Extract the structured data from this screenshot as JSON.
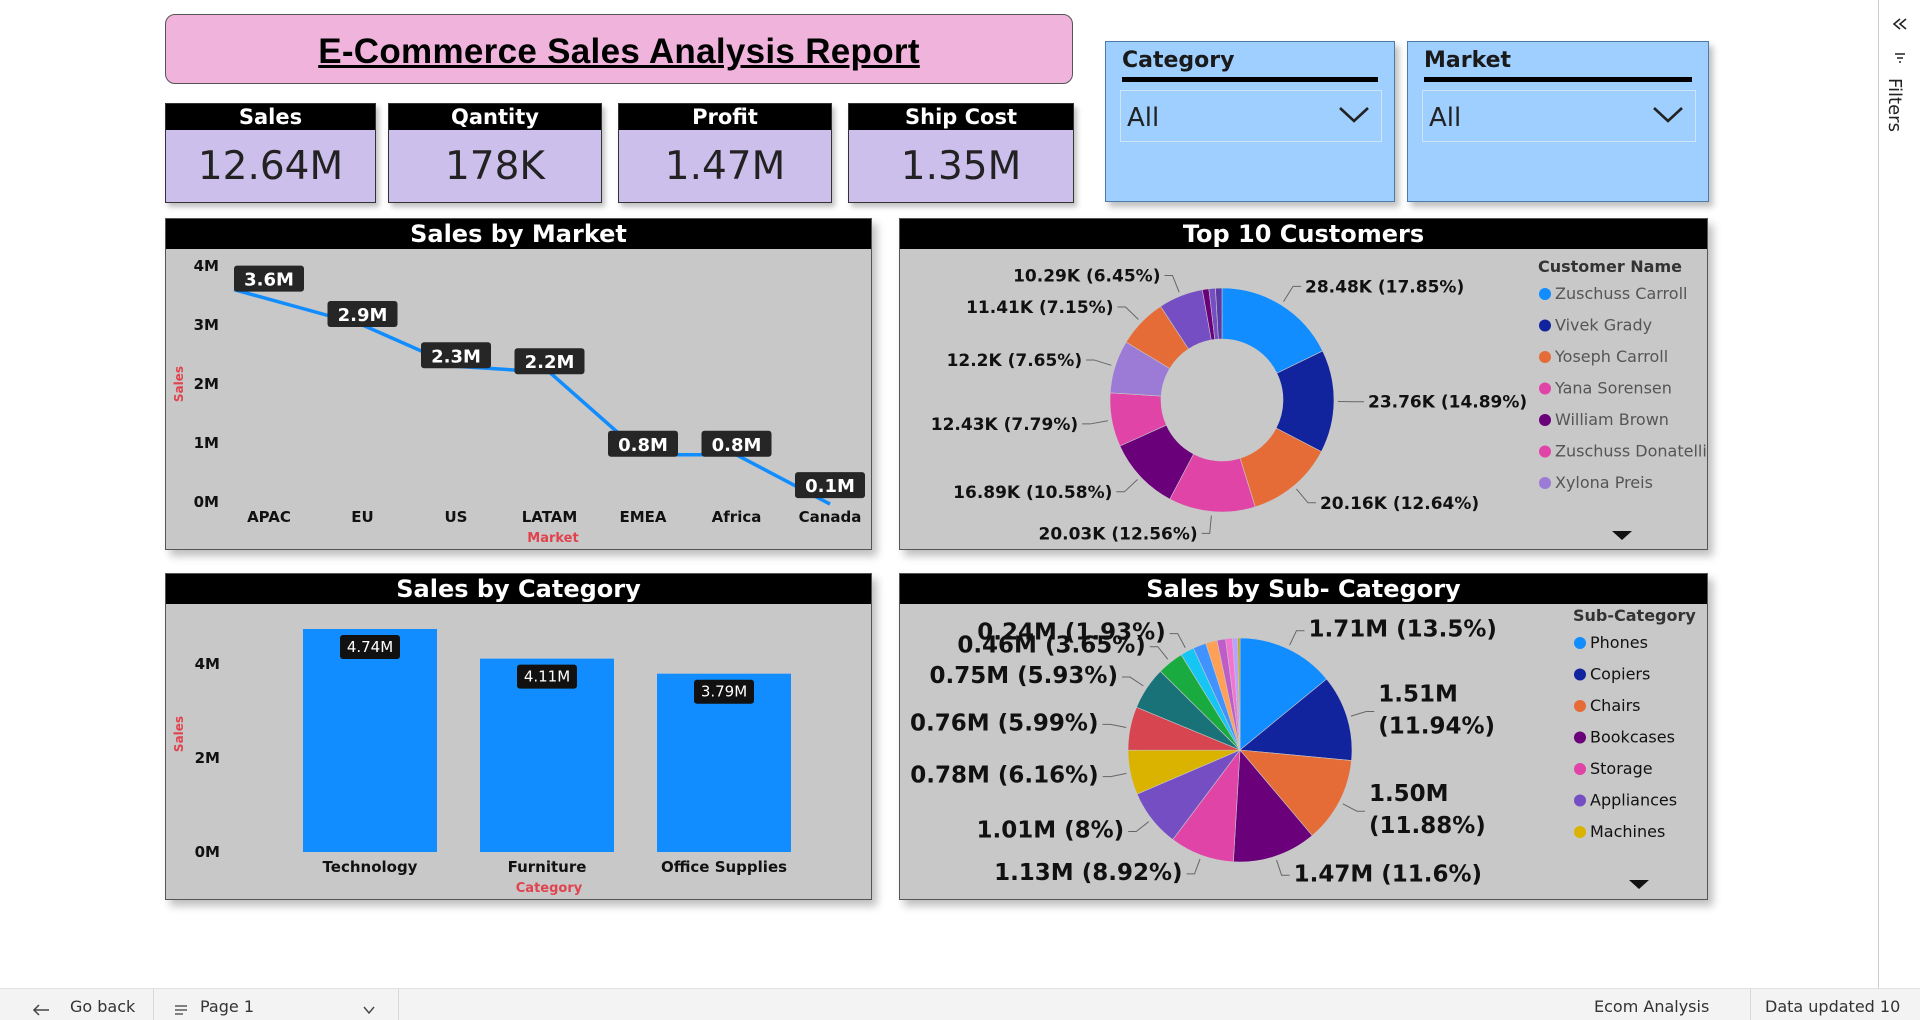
{
  "report": {
    "title": "E-Commerce Sales Analysis Report"
  },
  "kpis": [
    {
      "label": "Sales",
      "value": "12.64M"
    },
    {
      "label": "Qantity",
      "value": "178K"
    },
    {
      "label": "Profit",
      "value": "1.47M"
    },
    {
      "label": "Ship Cost",
      "value": "1.35M"
    }
  ],
  "slicers": [
    {
      "label": "Category",
      "value": "All"
    },
    {
      "label": "Market",
      "value": "All"
    }
  ],
  "filters_pane": {
    "label": "Filters"
  },
  "colors": {
    "title_bg": "#f0b4dc",
    "kpi_bg": "#cdbfec",
    "slicer_bg": "#9ecfff",
    "panel_bg": "#c8c8c8",
    "series_blue": "#118dff",
    "axis_label_red": "#e0434e"
  },
  "status_bar": {
    "back": "Go back",
    "page": "Page 1",
    "report_name": "Ecom Analysis",
    "data_updated": "Data updated 10"
  },
  "icons": [
    "back-arrow-icon",
    "page-icon",
    "chevron-down-icon",
    "collapse-icon",
    "filter-icon"
  ],
  "chart_data": [
    {
      "type": "line",
      "title": "Sales by Market",
      "xlabel": "Market",
      "ylabel": "Sales",
      "categories": [
        "APAC",
        "EU",
        "US",
        "LATAM",
        "EMEA",
        "Africa",
        "Canada"
      ],
      "values": [
        3.6,
        3.0,
        2.3,
        2.2,
        0.8,
        0.8,
        0.1
      ],
      "labels": [
        "3.6M",
        "2.9M",
        "2.3M",
        "2.2M",
        "0.8M",
        "0.8M",
        "0.1M"
      ],
      "yticks": [
        "0M",
        "1M",
        "2M",
        "3M",
        "4M"
      ],
      "ylim": [
        0,
        4
      ],
      "unit": "M"
    },
    {
      "type": "pie",
      "title": "Top 10 Customers",
      "legend_title": "Customer Name",
      "legend": [
        "Zuschuss Carroll",
        "Vivek Grady",
        "Yoseph Carroll",
        "Yana Sorensen",
        "William Brown",
        "Zuschuss Donatelli",
        "Xylona Preis"
      ],
      "values": [
        28.48,
        23.76,
        20.16,
        20.03,
        16.89,
        12.43,
        12.2,
        11.41,
        10.29,
        1.5,
        1.5,
        1.5
      ],
      "labels": [
        "28.48K (17.85%)",
        "23.76K (14.89%)",
        "20.16K (12.64%)",
        "20.03K (12.56%)",
        "16.89K (10.58%)",
        "12.43K (7.79%)",
        "12.2K (7.65%)",
        "11.41K (7.15%)",
        "10.29K (6.45%)",
        "",
        "",
        ""
      ],
      "colors": [
        "#118dff",
        "#12239e",
        "#e66c37",
        "#e044a7",
        "#6b007b",
        "#e044a7",
        "#9b7bd6",
        "#e66c37",
        "#744ec2",
        "#6b007b",
        "#744ec2",
        "#5c3aa5"
      ],
      "donut": true
    },
    {
      "type": "bar",
      "title": "Sales by Category",
      "xlabel": "Category",
      "ylabel": "Sales",
      "categories": [
        "Technology",
        "Furniture",
        "Office Supplies"
      ],
      "values": [
        4.74,
        4.11,
        3.79
      ],
      "labels": [
        "4.74M",
        "4.11M",
        "3.79M"
      ],
      "yticks": [
        "0M",
        "2M",
        "4M"
      ],
      "ylim": [
        0,
        4.74
      ]
    },
    {
      "type": "pie",
      "title": "Sales by Sub- Category",
      "legend_title": "Sub-Category",
      "legend": [
        "Phones",
        "Copiers",
        "Chairs",
        "Bookcases",
        "Storage",
        "Appliances",
        "Machines"
      ],
      "values": [
        1.71,
        1.51,
        1.5,
        1.47,
        1.13,
        1.01,
        0.78,
        0.76,
        0.75,
        0.46,
        0.24,
        0.23,
        0.2,
        0.15,
        0.12,
        0.09,
        0.04
      ],
      "labels": [
        "1.71M (13.5%)",
        "1.51M (11.94%)",
        "1.50M (11.88%)",
        "1.47M (11.6%)",
        "1.13M (8.92%)",
        "1.01M (8%)",
        "0.78M (6.16%)",
        "0.76M (5.99%)",
        "0.75M (5.93%)",
        "0.46M (3.65%)",
        "0.24M (1.93%)",
        "",
        "",
        "",
        "",
        "",
        ""
      ],
      "colors": [
        "#118dff",
        "#12239e",
        "#e66c37",
        "#6b007b",
        "#e044a7",
        "#744ec2",
        "#d9b300",
        "#d64550",
        "#197278",
        "#1aab40",
        "#15c6f4",
        "#4092ff",
        "#ffa058",
        "#be5dc9",
        "#f472d0",
        "#b5a1ff",
        "#c4a200"
      ],
      "donut": false
    }
  ]
}
